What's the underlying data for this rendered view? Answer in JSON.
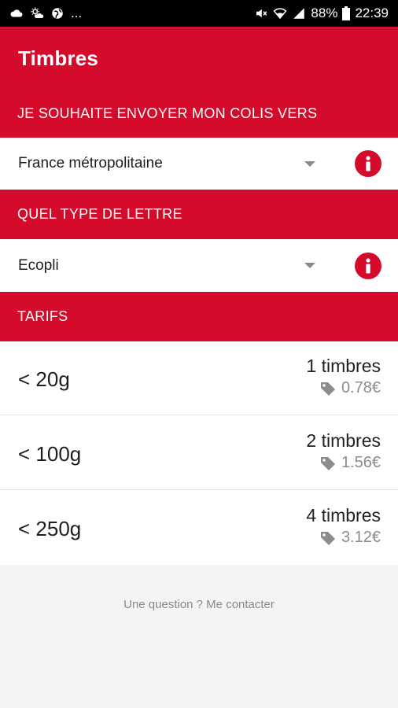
{
  "status_bar": {
    "time": "22:39",
    "battery": "88%",
    "left_dots": "...",
    "icons": [
      "cloud-icon",
      "weather-icon",
      "globe-icon",
      "mute-icon",
      "wifi-icon",
      "signal-icon",
      "battery-icon"
    ]
  },
  "app": {
    "title": "Timbres",
    "accent_color": "#d50b2c"
  },
  "destination": {
    "header": "JE SOUHAITE ENVOYER MON COLIS VERS",
    "selected": "France métropolitaine"
  },
  "letter_type": {
    "header": "QUEL TYPE DE LETTRE",
    "selected": "Ecopli"
  },
  "tarifs": {
    "header": "TARIFS",
    "rows": [
      {
        "weight": "< 20g",
        "stamps": "1 timbres",
        "price": "0.78€"
      },
      {
        "weight": "< 100g",
        "stamps": "2 timbres",
        "price": "1.56€"
      },
      {
        "weight": "< 250g",
        "stamps": "4 timbres",
        "price": "3.12€"
      }
    ]
  },
  "footer": {
    "contact_link": "Une question ? Me contacter"
  }
}
